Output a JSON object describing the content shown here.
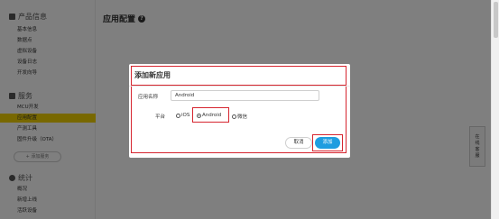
{
  "sidebar": {
    "sections": [
      {
        "label": "产品信息",
        "icon": "grid-icon"
      },
      {
        "label": "服务",
        "icon": "book-icon"
      },
      {
        "label": "统计",
        "icon": "pie-chart-icon"
      }
    ],
    "product_items": [
      "基本信息",
      "数据点",
      "虚拟设备",
      "设备日志",
      "开发向导"
    ],
    "service_items": [
      "MCU开发",
      "应用配置",
      "产测工具",
      "固件升级（OTA）"
    ],
    "add_service_label": "+ 添加服务",
    "stats_items": [
      "概况",
      "新增上线",
      "活跃设备"
    ]
  },
  "main": {
    "title": "应用配置",
    "help_icon": "question-circle-icon"
  },
  "side_tab": {
    "label": [
      "在",
      "线",
      "客",
      "服"
    ]
  },
  "modal": {
    "title": "添加新应用",
    "name_label": "应用名称",
    "name_value": "Android",
    "platform_label": "平台",
    "platform_options": [
      "iOS",
      "Android",
      "微信"
    ],
    "platform_selected": "Android",
    "cancel_label": "取消",
    "add_label": "添加"
  },
  "colors": {
    "accent": "#1e9de0",
    "highlight": "#d6252f",
    "active_nav": "#f1d100"
  }
}
